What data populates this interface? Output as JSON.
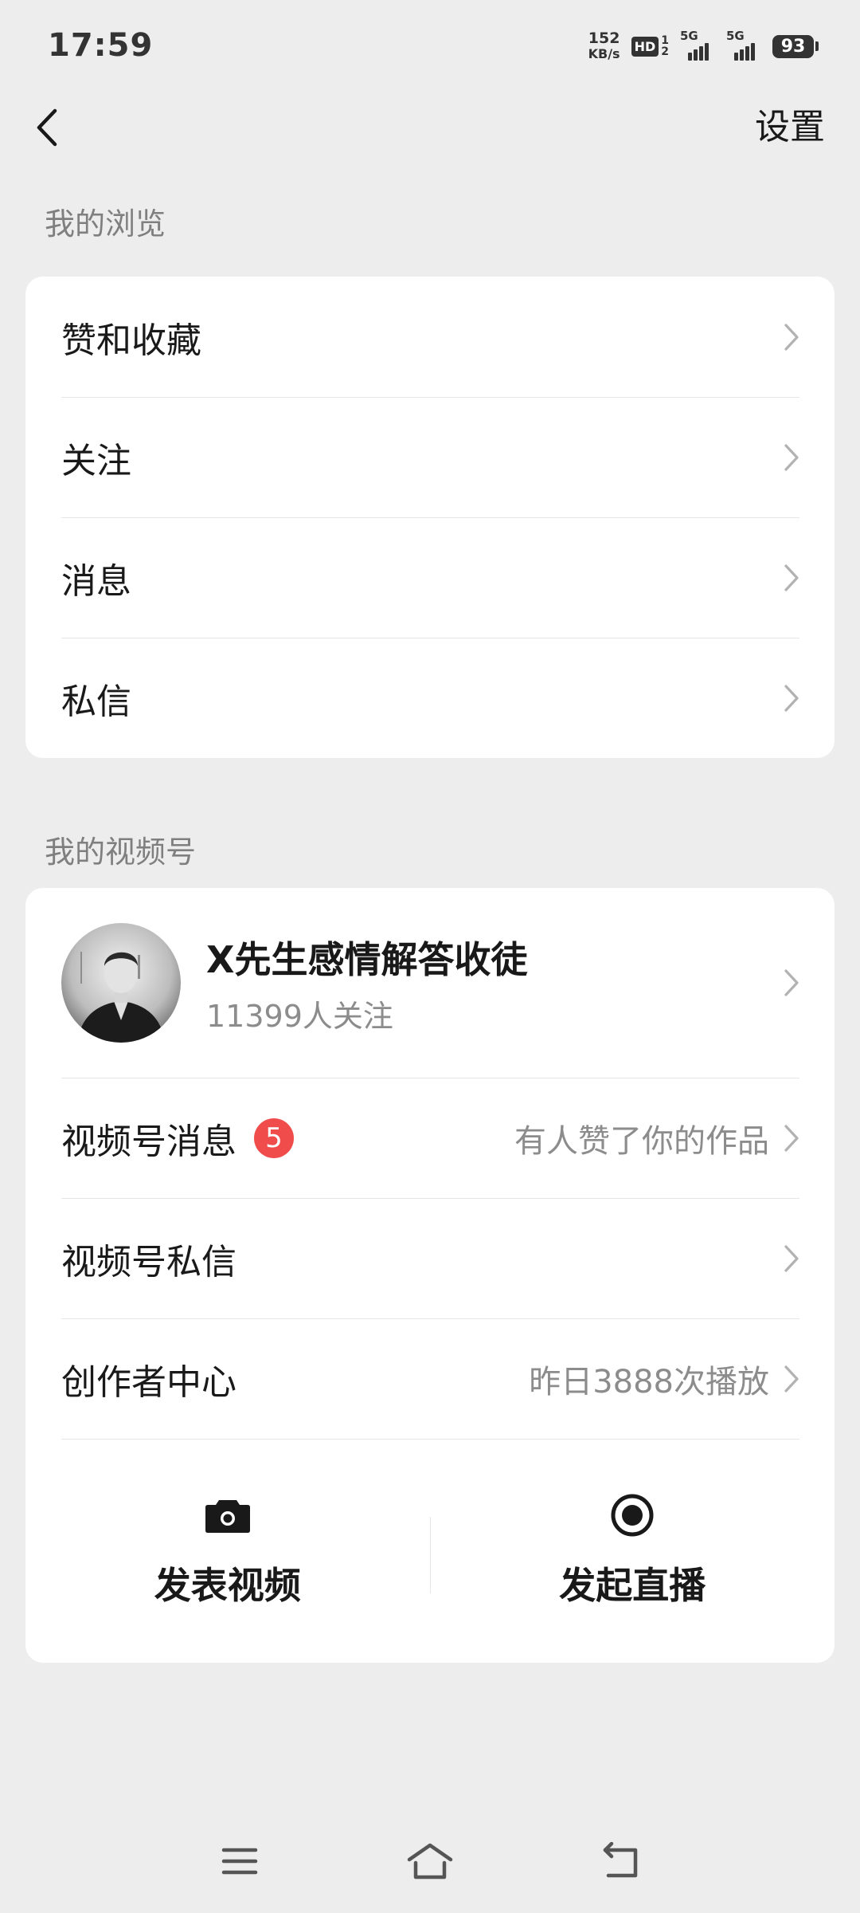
{
  "status_bar": {
    "time": "17:59",
    "net_speed_value": "152",
    "net_speed_unit": "KB/s",
    "hd_label": "HD",
    "hd_sub_top": "1",
    "hd_sub_bottom": "2",
    "sim1_label": "5G",
    "sim2_label": "5G",
    "battery": "93"
  },
  "nav": {
    "settings_label": "设置"
  },
  "browse": {
    "title": "我的浏览",
    "items": [
      {
        "label": "赞和收藏"
      },
      {
        "label": "关注"
      },
      {
        "label": "消息"
      },
      {
        "label": "私信"
      }
    ]
  },
  "channels": {
    "title": "我的视频号",
    "profile": {
      "name": "X先生感情解答收徒",
      "followers": "11399人关注"
    },
    "messages": {
      "label": "视频号消息",
      "badge": "5",
      "sub": "有人赞了你的作品"
    },
    "private_messages": {
      "label": "视频号私信"
    },
    "creator_center": {
      "label": "创作者中心",
      "sub": "昨日3888次播放"
    },
    "actions": {
      "publish_label": "发表视频",
      "live_label": "发起直播"
    }
  },
  "colors": {
    "background": "#ededed",
    "card": "#ffffff",
    "badge": "#f04c4c",
    "secondary_text": "#8c8c8c"
  },
  "icons": [
    "back-arrow-icon",
    "chevron-right-icon",
    "camera-icon",
    "live-record-icon",
    "menu-icon",
    "home-icon",
    "return-icon"
  ]
}
